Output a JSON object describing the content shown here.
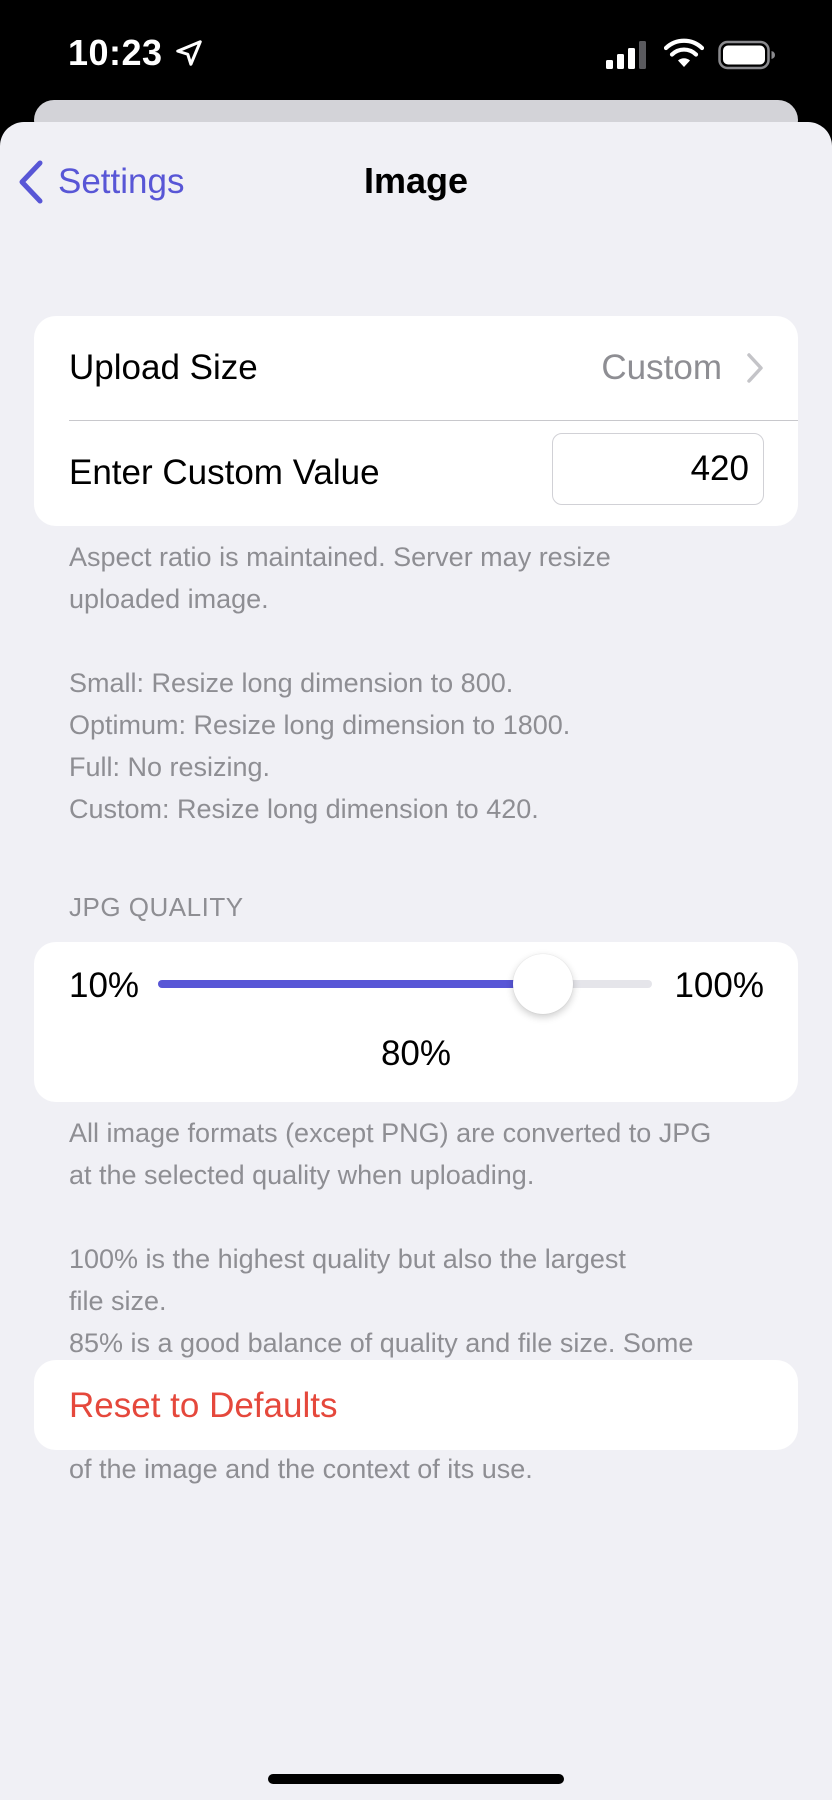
{
  "status_bar": {
    "time": "10:23"
  },
  "nav": {
    "back_label": "Settings",
    "title": "Image"
  },
  "upload": {
    "size_label": "Upload Size",
    "size_value": "Custom",
    "custom_label": "Enter Custom Value",
    "custom_value": "420",
    "footnote": "Aspect ratio is maintained. Server may resize\nuploaded image.\n\nSmall: Resize long dimension to 800.\nOptimum: Resize long dimension to 1800.\nFull: No resizing.\nCustom: Resize long dimension to 420."
  },
  "jpg_quality": {
    "header": "JPG QUALITY",
    "min_label": "10%",
    "max_label": "100%",
    "value_label": "80%",
    "level_fraction": 0.78,
    "footnote": "All image formats (except PNG) are converted to JPG\nat the selected quality when uploading.\n\n100% is the highest quality but also the largest\nfile size.\n85% is a good balance of quality and file size. Some\nmay disagree ;-)\nSmaller values can suffice depending on the content\nof the image and the context of its use."
  },
  "reset": {
    "label": "Reset to Defaults"
  },
  "colors": {
    "accent": "#5856d6",
    "destructive": "#e5483c",
    "background": "#f0f0f5",
    "secondary_text": "#8e8e93"
  }
}
